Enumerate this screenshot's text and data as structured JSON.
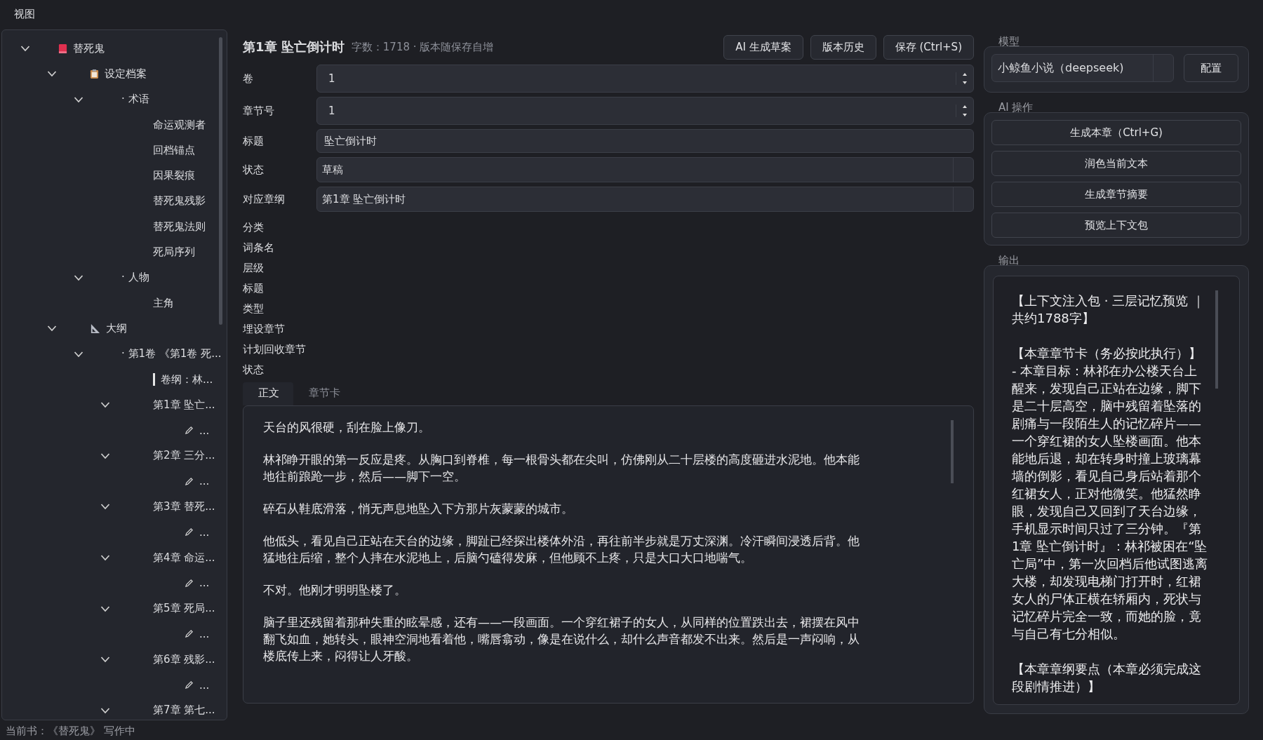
{
  "menu": [
    "视图"
  ],
  "tree": [
    {
      "label": "替死鬼",
      "kind": "book",
      "expanded": true,
      "children": [
        {
          "label": "设定档案",
          "kind": "archive",
          "expanded": true,
          "children": [
            {
              "label": "· 术语",
              "expanded": true,
              "children": [
                {
                  "label": "命运观测者"
                },
                {
                  "label": "回档锚点"
                },
                {
                  "label": "因果裂痕"
                },
                {
                  "label": "替死鬼残影"
                },
                {
                  "label": "替死鬼法则"
                },
                {
                  "label": "死局序列"
                }
              ]
            },
            {
              "label": "· 人物",
              "expanded": true,
              "children": [
                {
                  "label": "主角"
                }
              ]
            }
          ]
        },
        {
          "label": "大纲",
          "kind": "outline",
          "expanded": true,
          "children": [
            {
              "label": "· 第1卷 《第1卷 死...",
              "expanded": true,
              "children": [
                {
                  "label": "卷纲：林...",
                  "kind": "volume"
                },
                {
                  "label": "第1章 坠亡...",
                  "expanded": true,
                  "children": [
                    {
                      "label": "...",
                      "kind": "draft"
                    }
                  ]
                },
                {
                  "label": "第2章 三分...",
                  "expanded": true,
                  "children": [
                    {
                      "label": "...",
                      "kind": "draft"
                    }
                  ]
                },
                {
                  "label": "第3章 替死...",
                  "expanded": true,
                  "children": [
                    {
                      "label": "...",
                      "kind": "draft"
                    }
                  ]
                },
                {
                  "label": "第4章 命运...",
                  "expanded": true,
                  "children": [
                    {
                      "label": "...",
                      "kind": "draft"
                    }
                  ]
                },
                {
                  "label": "第5章 死局...",
                  "expanded": true,
                  "children": [
                    {
                      "label": "...",
                      "kind": "draft"
                    }
                  ]
                },
                {
                  "label": "第6章 残影...",
                  "expanded": true,
                  "children": [
                    {
                      "label": "...",
                      "kind": "draft"
                    }
                  ]
                },
                {
                  "label": "第7章 第七...",
                  "expanded": true
                }
              ]
            }
          ]
        }
      ]
    }
  ],
  "editor": {
    "title": "第1章 坠亡倒计时",
    "meta": "字数：1718 · 版本随保存自增",
    "buttons": [
      "AI 生成草案",
      "版本历史",
      "保存 (Ctrl+S)"
    ],
    "fields": [
      {
        "label": "卷",
        "kind": "spin",
        "value": "1"
      },
      {
        "label": "章节号",
        "kind": "spin",
        "value": "1"
      },
      {
        "label": "标题",
        "kind": "text",
        "value": "坠亡倒计时"
      },
      {
        "label": "状态",
        "kind": "combo",
        "value": "草稿"
      },
      {
        "label": "对应章纲",
        "kind": "combo",
        "value": "第1章 坠亡倒计时"
      }
    ],
    "extra_labels": [
      "分类",
      "词条名",
      "层级",
      "标题",
      "类型",
      "埋设章节",
      "计划回收章节",
      "状态"
    ],
    "tabs": [
      {
        "label": "正文",
        "selected": true
      },
      {
        "label": "章节卡",
        "selected": false
      }
    ],
    "body": [
      "天台的风很硬，刮在脸上像刀。",
      "林祁睁开眼的第一反应是疼。从胸口到脊椎，每一根骨头都在尖叫，仿佛刚从二十层楼的高度砸进水泥地。他本能地往前踉跄一步，然后——脚下一空。",
      "碎石从鞋底滑落，悄无声息地坠入下方那片灰蒙蒙的城市。",
      "他低头，看见自己正站在天台的边缘，脚趾已经探出楼体外沿，再往前半步就是万丈深渊。冷汗瞬间浸透后背。他猛地往后缩，整个人摔在水泥地上，后脑勺磕得发麻，但他顾不上疼，只是大口大口地喘气。",
      "不对。他刚才明明坠楼了。",
      "脑子里还残留着那种失重的眩晕感，还有——一段画面。一个穿红裙子的女人，从同样的位置跌出去，裙摆在风中翻飞如血，她转头，眼神空洞地看着他，嘴唇翕动，像是在说什么，却什么声音都发不出来。然后是一声闷响，从楼底传上来，闷得让人牙酸。"
    ]
  },
  "side": {
    "model_title": "模型",
    "model": "小鲸鱼小说（deepseek)",
    "config": "配置",
    "ai_title": "AI 操作",
    "ai_buttons": [
      "生成本章（Ctrl+G)",
      "润色当前文本",
      "生成章节摘要",
      "预览上下文包"
    ],
    "output_title": "输出",
    "output": [
      "【上下文注入包 · 三层记忆预览 ｜共约1788字】",
      "【本章章节卡（务必按此执行）】\n- 本章目标：林祁在办公楼天台上醒来，发现自己正站在边缘，脚下是二十层高空，脑中残留着坠落的剧痛与一段陌生人的记忆碎片——一个穿红裙的女人坠楼画面。他本能地后退，却在转身时撞上玻璃幕墙的倒影，看见自己身后站着那个红裙女人，正对他微笑。他猛然睁眼，发现自己又回到了天台边缘，手机显示时间只过了三分钟。『第1章 坠亡倒计时』：林祁被困在“坠亡局”中，第一次回档后他试图逃离大楼，却发现电梯门打开时，红裙女人的尸体正横在轿厢内，死状与记忆碎片完全一致，而她的脸，竟与自己有七分相似。",
      "【本章章纲要点（本章必须完成这段剧情推进）】"
    ]
  },
  "status": "当前书：《替死鬼》 写作中"
}
